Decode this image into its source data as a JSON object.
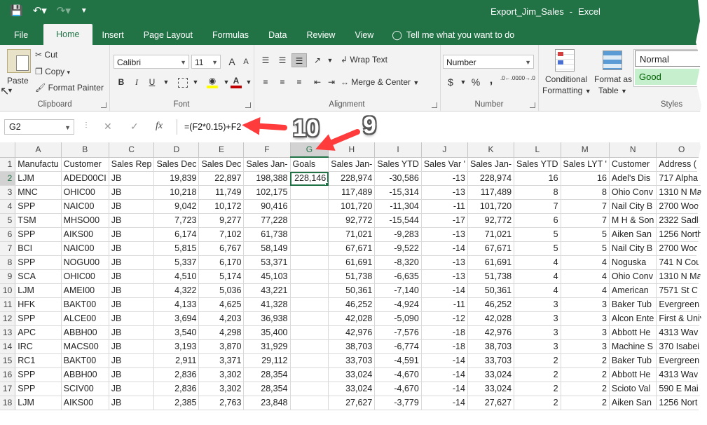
{
  "titlebar": {
    "file_title": "Export_Jim_Sales",
    "separator": "-",
    "app_name": "Excel",
    "qat_icons": [
      "save-icon",
      "undo-icon",
      "redo-icon",
      "customize-qat-icon"
    ]
  },
  "tabs": [
    {
      "label": "File"
    },
    {
      "label": "Home"
    },
    {
      "label": "Insert"
    },
    {
      "label": "Page Layout"
    },
    {
      "label": "Formulas"
    },
    {
      "label": "Data"
    },
    {
      "label": "Review"
    },
    {
      "label": "View"
    }
  ],
  "tell_me": "Tell me what you want to do",
  "ribbon": {
    "clipboard": {
      "label": "Clipboard",
      "paste": "Paste",
      "cut": "Cut",
      "copy": "Copy",
      "format_painter": "Format Painter"
    },
    "font": {
      "label": "Font",
      "font_name": "Calibri",
      "font_size": "11",
      "bold": "B",
      "italic": "I",
      "underline": "U",
      "fill_color": "#ffff00",
      "font_color": "#c00000",
      "grow": "A",
      "shrink": "A"
    },
    "alignment": {
      "label": "Alignment",
      "wrap_text": "Wrap Text",
      "merge_center": "Merge & Center"
    },
    "number": {
      "label": "Number",
      "format": "Number",
      "currency": "$",
      "percent": "%",
      "comma": ",",
      "inc_decimal": ".0←.00",
      "dec_decimal": ".00→.0"
    },
    "styles": {
      "label": "Styles",
      "conditional_formatting_1": "Conditional",
      "conditional_formatting_2": "Formatting",
      "format_as_table_1": "Format as",
      "format_as_table_2": "Table",
      "style_normal": "Normal",
      "style_good": "Good"
    }
  },
  "formula_bar": {
    "name_box": "G2",
    "cancel": "✕",
    "enter": "✓",
    "fx": "fx",
    "formula": "=(F2*0.15)+F2"
  },
  "annotations": {
    "callout_10": "10",
    "callout_9": "9",
    "arrow_color": "#ff3b3b"
  },
  "sheet": {
    "columns": [
      "A",
      "B",
      "C",
      "D",
      "E",
      "F",
      "G",
      "H",
      "I",
      "J",
      "K",
      "L",
      "M",
      "N",
      "O"
    ],
    "selected_column": "G",
    "active_cell": "G2",
    "rows": [
      {
        "n": "1",
        "cells": [
          "Manufactu",
          "Customer",
          "Sales Rep",
          "Sales Dec",
          "Sales Dec",
          "Sales Jan-",
          "Goals",
          "Sales Jan-",
          "Sales YTD",
          "Sales Var '",
          "Sales Jan-",
          "Sales YTD",
          "Sales LYT '",
          "Customer",
          "Address ("
        ]
      },
      {
        "n": "2",
        "cells": [
          "LJM",
          "ADED00CI",
          "JB",
          "19,839",
          "22,897",
          "198,388",
          "228,146",
          "228,974",
          "-30,586",
          "-13",
          "228,974",
          "16",
          "16",
          "Adel's Dis",
          "717 Alpha"
        ]
      },
      {
        "n": "3",
        "cells": [
          "MNC",
          "OHIC00",
          "JB",
          "10,218",
          "11,749",
          "102,175",
          "",
          "117,489",
          "-15,314",
          "-13",
          "117,489",
          "8",
          "8",
          "Ohio Conv",
          "1310 N Ma"
        ]
      },
      {
        "n": "4",
        "cells": [
          "SPP",
          "NAIC00",
          "JB",
          "9,042",
          "10,172",
          "90,416",
          "",
          "101,720",
          "-11,304",
          "-11",
          "101,720",
          "7",
          "7",
          "Nail City B",
          "2700 Woo"
        ]
      },
      {
        "n": "5",
        "cells": [
          "TSM",
          "MHSO00",
          "JB",
          "7,723",
          "9,277",
          "77,228",
          "",
          "92,772",
          "-15,544",
          "-17",
          "92,772",
          "6",
          "7",
          "M H & Son",
          "2322 Sadle"
        ]
      },
      {
        "n": "6",
        "cells": [
          "SPP",
          "AIKS00",
          "JB",
          "6,174",
          "7,102",
          "61,738",
          "",
          "71,021",
          "-9,283",
          "-13",
          "71,021",
          "5",
          "5",
          "Aiken San",
          "1256 North"
        ]
      },
      {
        "n": "7",
        "cells": [
          "BCI",
          "NAIC00",
          "JB",
          "5,815",
          "6,767",
          "58,149",
          "",
          "67,671",
          "-9,522",
          "-14",
          "67,671",
          "5",
          "5",
          "Nail City B",
          "2700 Wood"
        ]
      },
      {
        "n": "8",
        "cells": [
          "SPP",
          "NOGU00",
          "JB",
          "5,337",
          "6,170",
          "53,371",
          "",
          "61,691",
          "-8,320",
          "-13",
          "61,691",
          "4",
          "4",
          "Noguska",
          "741 N Cou"
        ]
      },
      {
        "n": "9",
        "cells": [
          "SCA",
          "OHIC00",
          "JB",
          "4,510",
          "5,174",
          "45,103",
          "",
          "51,738",
          "-6,635",
          "-13",
          "51,738",
          "4",
          "4",
          "Ohio Conv",
          "1310 N Ma"
        ]
      },
      {
        "n": "10",
        "cells": [
          "LJM",
          "AMEI00",
          "JB",
          "4,322",
          "5,036",
          "43,221",
          "",
          "50,361",
          "-7,140",
          "-14",
          "50,361",
          "4",
          "4",
          "American",
          "7571 St Ch"
        ]
      },
      {
        "n": "11",
        "cells": [
          "HFK",
          "BAKT00",
          "JB",
          "4,133",
          "4,625",
          "41,328",
          "",
          "46,252",
          "-4,924",
          "-11",
          "46,252",
          "3",
          "3",
          "Baker Tub",
          "Evergreen"
        ]
      },
      {
        "n": "12",
        "cells": [
          "SPP",
          "ALCE00",
          "JB",
          "3,694",
          "4,203",
          "36,938",
          "",
          "42,028",
          "-5,090",
          "-12",
          "42,028",
          "3",
          "3",
          "Alcon Ente",
          "First & Univ"
        ]
      },
      {
        "n": "13",
        "cells": [
          "APC",
          "ABBH00",
          "JB",
          "3,540",
          "4,298",
          "35,400",
          "",
          "42,976",
          "-7,576",
          "-18",
          "42,976",
          "3",
          "3",
          "Abbott He",
          "4313 Wave"
        ]
      },
      {
        "n": "14",
        "cells": [
          "IRC",
          "MACS00",
          "JB",
          "3,193",
          "3,870",
          "31,929",
          "",
          "38,703",
          "-6,774",
          "-18",
          "38,703",
          "3",
          "3",
          "Machine S",
          "370 Isabell"
        ]
      },
      {
        "n": "15",
        "cells": [
          "RC1",
          "BAKT00",
          "JB",
          "2,911",
          "3,371",
          "29,112",
          "",
          "33,703",
          "-4,591",
          "-14",
          "33,703",
          "2",
          "2",
          "Baker Tub",
          "Evergreen"
        ]
      },
      {
        "n": "16",
        "cells": [
          "SPP",
          "ABBH00",
          "JB",
          "2,836",
          "3,302",
          "28,354",
          "",
          "33,024",
          "-4,670",
          "-14",
          "33,024",
          "2",
          "2",
          "Abbott He",
          "4313 Wave"
        ]
      },
      {
        "n": "17",
        "cells": [
          "SPP",
          "SCIV00",
          "JB",
          "2,836",
          "3,302",
          "28,354",
          "",
          "33,024",
          "-4,670",
          "-14",
          "33,024",
          "2",
          "2",
          "Scioto Val",
          "590 E Main"
        ]
      },
      {
        "n": "18",
        "cells": [
          "LJM",
          "AIKS00",
          "JB",
          "2,385",
          "2,763",
          "23,848",
          "",
          "27,627",
          "-3,779",
          "-14",
          "27,627",
          "2",
          "2",
          "Aiken San",
          "1256 Nort"
        ]
      }
    ]
  }
}
